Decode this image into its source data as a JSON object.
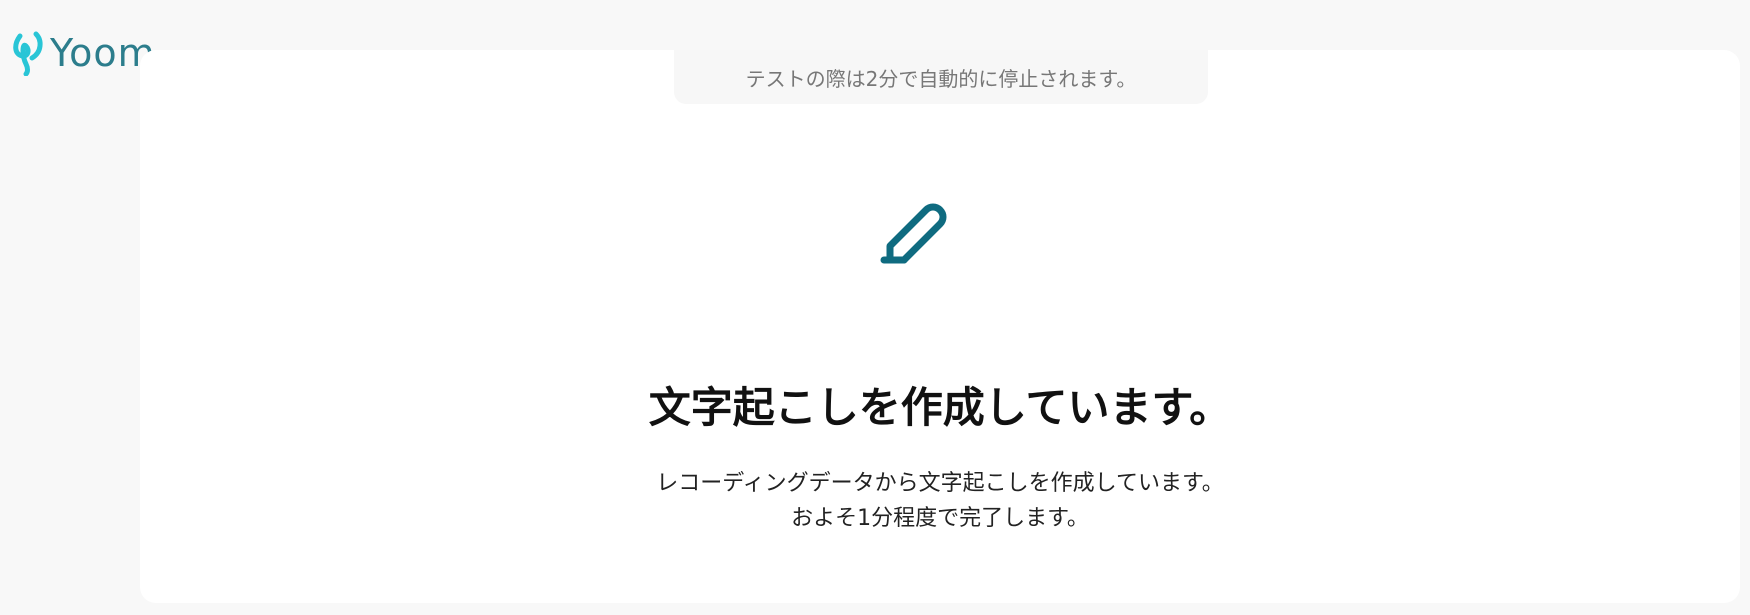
{
  "brand": {
    "name": "Yoom",
    "color": "#2c7d8c",
    "mark_color": "#29c5d6"
  },
  "notice": {
    "text": "テストの際は2分で自動的に停止されます。"
  },
  "status": {
    "icon": "pen-icon",
    "icon_color": "#0f6b80",
    "title": "文字起こしを作成しています。",
    "description_line1": "レコーディングデータから文字起こしを作成しています。",
    "description_line2": "およそ1分程度で完了します。"
  }
}
